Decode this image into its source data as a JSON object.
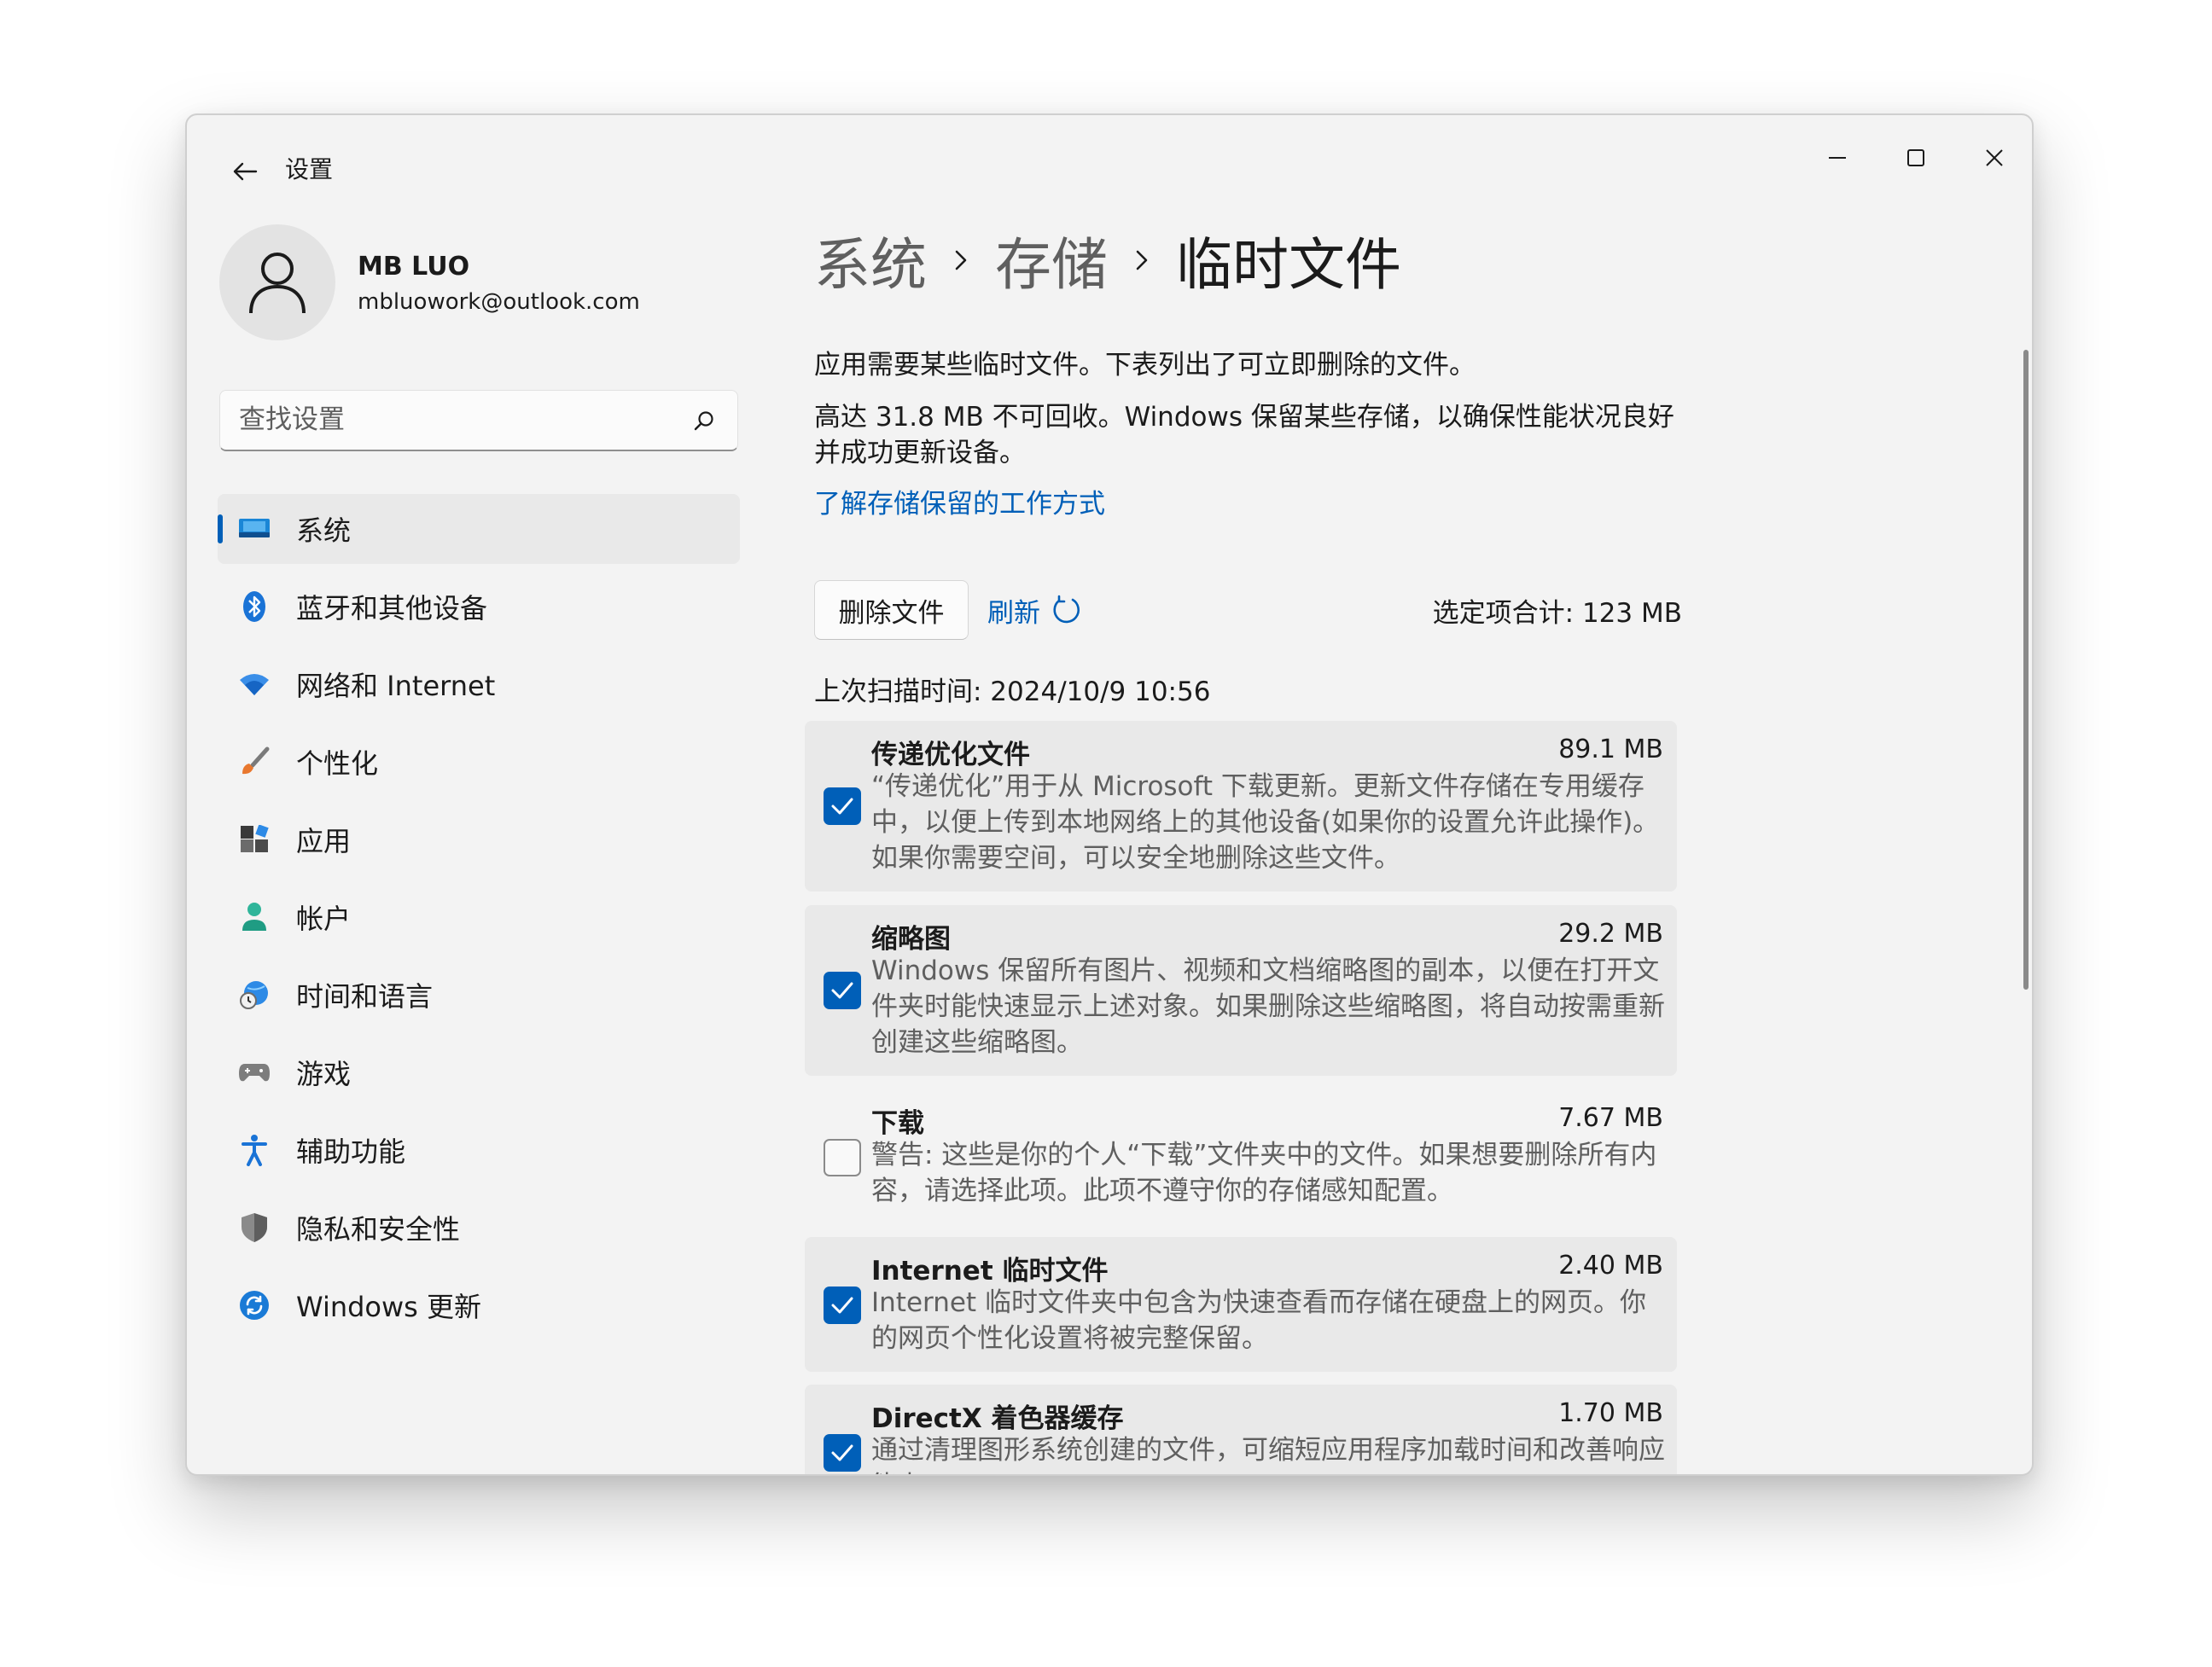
{
  "window": {
    "app_title": "设置"
  },
  "user": {
    "name": "MB LUO",
    "email": "mbluowork@outlook.com"
  },
  "search": {
    "placeholder": "查找设置"
  },
  "nav": {
    "items": [
      {
        "label": "系统",
        "icon": "system-display-icon",
        "active": true
      },
      {
        "label": "蓝牙和其他设备",
        "icon": "bluetooth-icon"
      },
      {
        "label": "网络和 Internet",
        "icon": "wifi-icon"
      },
      {
        "label": "个性化",
        "icon": "brush-icon"
      },
      {
        "label": "应用",
        "icon": "apps-icon"
      },
      {
        "label": "帐户",
        "icon": "account-icon"
      },
      {
        "label": "时间和语言",
        "icon": "globe-clock-icon"
      },
      {
        "label": "游戏",
        "icon": "gamepad-icon"
      },
      {
        "label": "辅助功能",
        "icon": "accessibility-icon"
      },
      {
        "label": "隐私和安全性",
        "icon": "shield-icon"
      },
      {
        "label": "Windows 更新",
        "icon": "windows-update-icon"
      }
    ]
  },
  "breadcrumb": {
    "items": [
      "系统",
      "存储",
      "临时文件"
    ]
  },
  "main": {
    "desc1": "应用需要某些临时文件。下表列出了可立即删除的文件。",
    "desc2": "高达 31.8 MB 不可回收。Windows 保留某些存储，以确保性能状况良好并成功更新设备。",
    "link": "了解存储保留的工作方式",
    "delete_label": "删除文件",
    "refresh_label": "刷新",
    "selected_total": "选定项合计: 123 MB",
    "scan_time": "上次扫描时间: 2024/10/9 10:56"
  },
  "files": [
    {
      "title": "传递优化文件",
      "size": "89.1 MB",
      "checked": true,
      "desc": "“传递优化”用于从 Microsoft 下载更新。更新文件存储在专用缓存中，以便上传到本地网络上的其他设备(如果你的设置允许此操作)。如果你需要空间，可以安全地删除这些文件。"
    },
    {
      "title": "缩略图",
      "size": "29.2 MB",
      "checked": true,
      "desc": "Windows 保留所有图片、视频和文档缩略图的副本，以便在打开文件夹时能快速显示上述对象。如果删除这些缩略图，将自动按需重新创建这些缩略图。"
    },
    {
      "title": "下载",
      "size": "7.67 MB",
      "checked": false,
      "desc": "警告: 这些是你的个人“下载”文件夹中的文件。如果想要删除所有内容，请选择此项。此项不遵守你的存储感知配置。"
    },
    {
      "title": "Internet 临时文件",
      "size": "2.40 MB",
      "checked": true,
      "desc": "Internet 临时文件夹中包含为快速查看而存储在硬盘上的网页。你的网页个性化设置将被完整保留。"
    },
    {
      "title": "DirectX 着色器缓存",
      "size": "1.70 MB",
      "checked": true,
      "desc": "通过清理图形系统创建的文件，可缩短应用程序加载时间和改善响应能力。"
    }
  ],
  "colors": {
    "accent": "#005fb8",
    "window_bg": "#f3f3f3",
    "selected_bg": "#e9e9e9"
  }
}
